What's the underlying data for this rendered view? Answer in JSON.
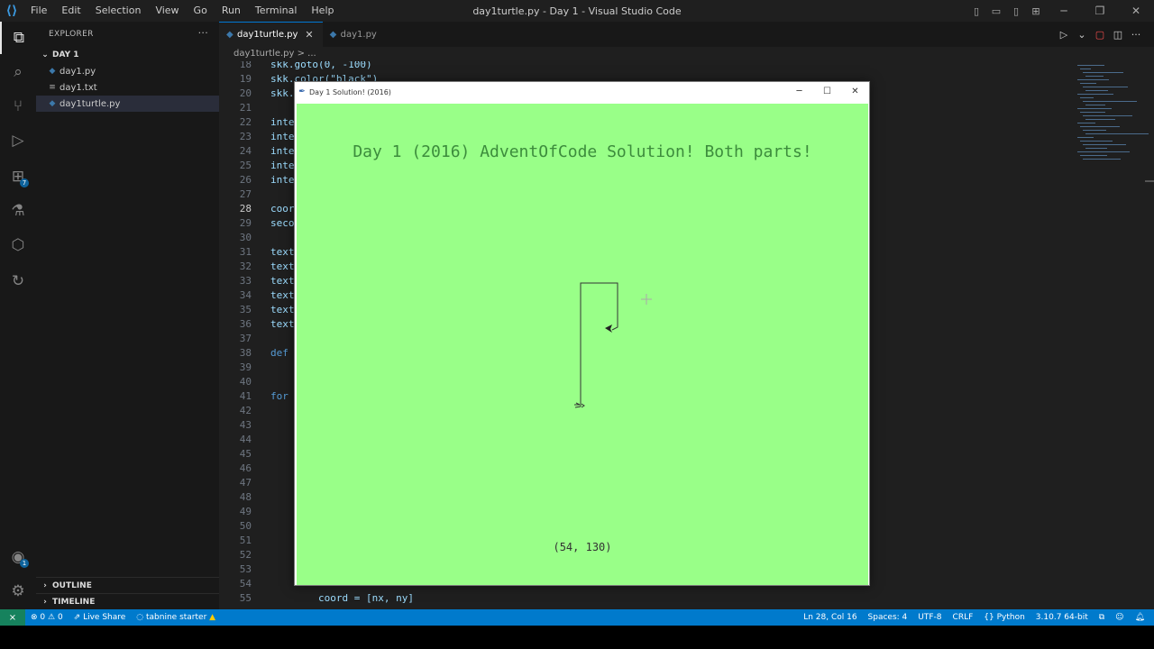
{
  "window_title": "day1turtle.py - Day 1 - Visual Studio Code",
  "menu": [
    "File",
    "Edit",
    "Selection",
    "View",
    "Go",
    "Run",
    "Terminal",
    "Help"
  ],
  "sidebar": {
    "header": "EXPLORER",
    "folder": "DAY 1",
    "files": [
      {
        "name": "day1.py",
        "icon": "python-file-icon"
      },
      {
        "name": "day1.txt",
        "icon": "text-file-icon"
      },
      {
        "name": "day1turtle.py",
        "icon": "python-file-icon",
        "selected": true
      }
    ],
    "outline": "OUTLINE",
    "timeline": "TIMELINE",
    "extensions_badge": "7",
    "accounts_badge": "1"
  },
  "tabs": [
    {
      "label": "day1turtle.py",
      "active": true
    },
    {
      "label": "day1.py",
      "active": false
    }
  ],
  "breadcrumb": "day1turtle.py > ...",
  "code_lines": [
    {
      "n": "18",
      "t": "skk.goto(0, -100)"
    },
    {
      "n": "19",
      "t": "skk.color(\"black\")"
    },
    {
      "n": "20",
      "t": "skk."
    },
    {
      "n": "21",
      "t": ""
    },
    {
      "n": "22",
      "t": "inte"
    },
    {
      "n": "23",
      "t": "inte"
    },
    {
      "n": "24",
      "t": "inte"
    },
    {
      "n": "25",
      "t": "inte"
    },
    {
      "n": "26",
      "t": "inte"
    },
    {
      "n": "27",
      "t": ""
    },
    {
      "n": "28",
      "t": "coor"
    },
    {
      "n": "29",
      "t": "seco"
    },
    {
      "n": "30",
      "t": ""
    },
    {
      "n": "31",
      "t": "text"
    },
    {
      "n": "32",
      "t": "text"
    },
    {
      "n": "33",
      "t": "text"
    },
    {
      "n": "34",
      "t": "text"
    },
    {
      "n": "35",
      "t": "text"
    },
    {
      "n": "36",
      "t": "text"
    },
    {
      "n": "37",
      "t": ""
    },
    {
      "n": "38",
      "t": "def"
    },
    {
      "n": "39",
      "t": ""
    },
    {
      "n": "40",
      "t": ""
    },
    {
      "n": "41",
      "t": "for"
    },
    {
      "n": "42",
      "t": ""
    },
    {
      "n": "43",
      "t": ""
    },
    {
      "n": "44",
      "t": ""
    },
    {
      "n": "45",
      "t": ""
    },
    {
      "n": "46",
      "t": ""
    },
    {
      "n": "47",
      "t": ""
    },
    {
      "n": "48",
      "t": ""
    },
    {
      "n": "49",
      "t": ""
    },
    {
      "n": "50",
      "t": ""
    },
    {
      "n": "51",
      "t": ""
    },
    {
      "n": "52",
      "t": ""
    },
    {
      "n": "53",
      "t": ""
    },
    {
      "n": "54",
      "t": ""
    },
    {
      "n": "55",
      "t": "        coord = [nx, ny]"
    }
  ],
  "turtle_window": {
    "title": "Day 1 Solution! (2016)",
    "heading": "Day 1 (2016) AdventOfCode Solution! Both parts!",
    "coords": "(54, 130)",
    "bg_color": "#99ff88"
  },
  "status": {
    "errors": "0",
    "warnings": "0",
    "live_share": "Live Share",
    "tabnine": "tabnine starter",
    "position": "Ln 28, Col 16",
    "spaces": "Spaces: 4",
    "encoding": "UTF-8",
    "eol": "CRLF",
    "language": "Python",
    "interpreter": "3.10.7 64-bit"
  },
  "colors": {
    "accent": "#007acc",
    "remote": "#16825d"
  }
}
